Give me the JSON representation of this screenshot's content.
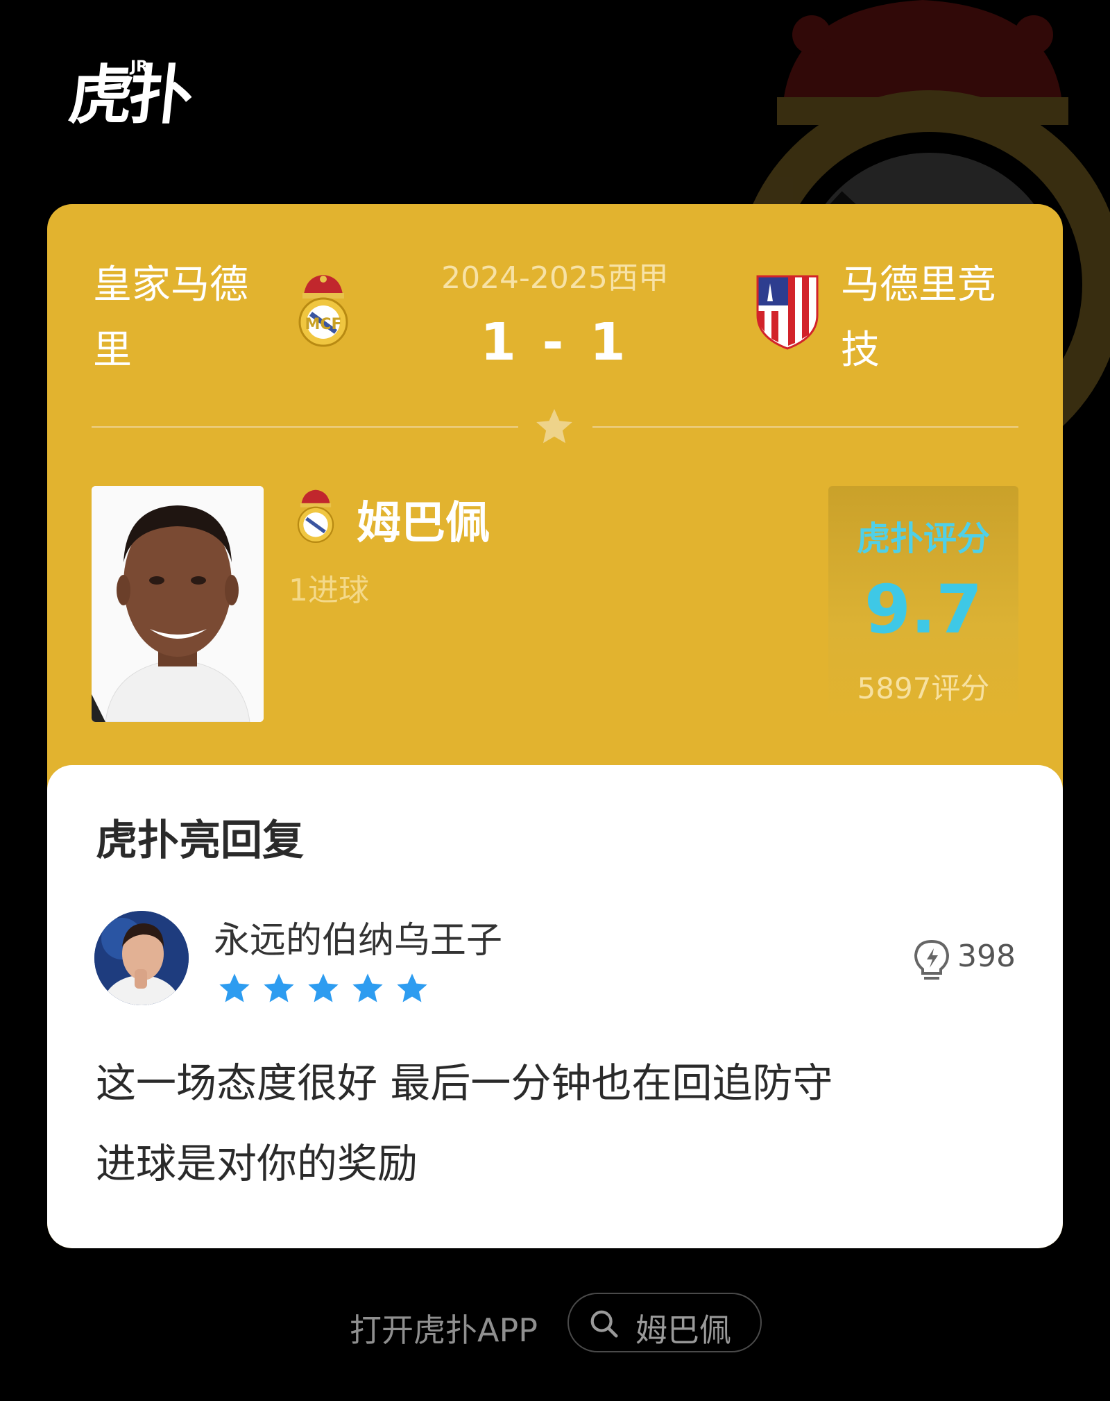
{
  "header": {
    "logo_text": "虎扑",
    "logo_jr": "JR"
  },
  "match": {
    "home_team": "皇家马德里",
    "away_team": "马德里竞技",
    "competition": "2024-2025西甲",
    "score": "1 - 1"
  },
  "player": {
    "name": "姆巴佩",
    "stat": "1进球"
  },
  "rating": {
    "brand": "虎扑评分",
    "score": "9.7",
    "count": "5897评分"
  },
  "reply": {
    "section_title": "虎扑亮回复",
    "user_name": "永远的伯纳乌王子",
    "stars": 5,
    "likes": "398",
    "body_line1": "这一场态度很好 最后一分钟也在回追防守",
    "body_line2": "进球是对你的奖励"
  },
  "footer": {
    "open_app": "打开虎扑APP",
    "search_query": "姆巴佩"
  },
  "colors": {
    "card": "#e2b32f",
    "rating_accent": "#3ec8e6",
    "star": "#2d9cf0"
  }
}
